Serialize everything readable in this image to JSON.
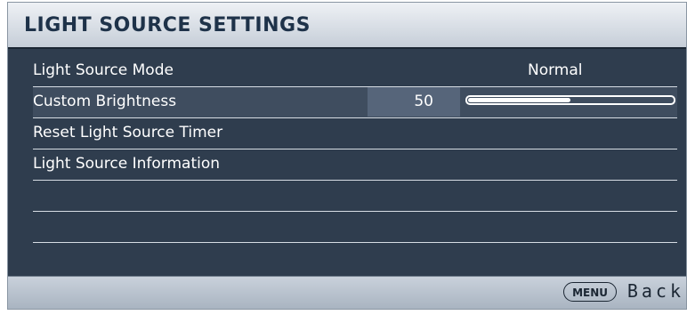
{
  "menu": {
    "title": "LIGHT SOURCE SETTINGS",
    "items": [
      {
        "label": "Light Source Mode",
        "value": "Normal"
      },
      {
        "label": "Custom Brightness",
        "value": "50",
        "slider_level_percent": 50
      },
      {
        "label": "Reset Light Source Timer"
      },
      {
        "label": "Light Source Information"
      }
    ]
  },
  "footer": {
    "menu_key": "MENU",
    "back_label": "Back"
  },
  "colors": {
    "panel_bg": "#2f3d4e",
    "title_bar": "#dde2e9",
    "selected_row": "#3f4d5f",
    "text": "#ffffff"
  },
  "icons": [
    "menu-key-icon"
  ]
}
